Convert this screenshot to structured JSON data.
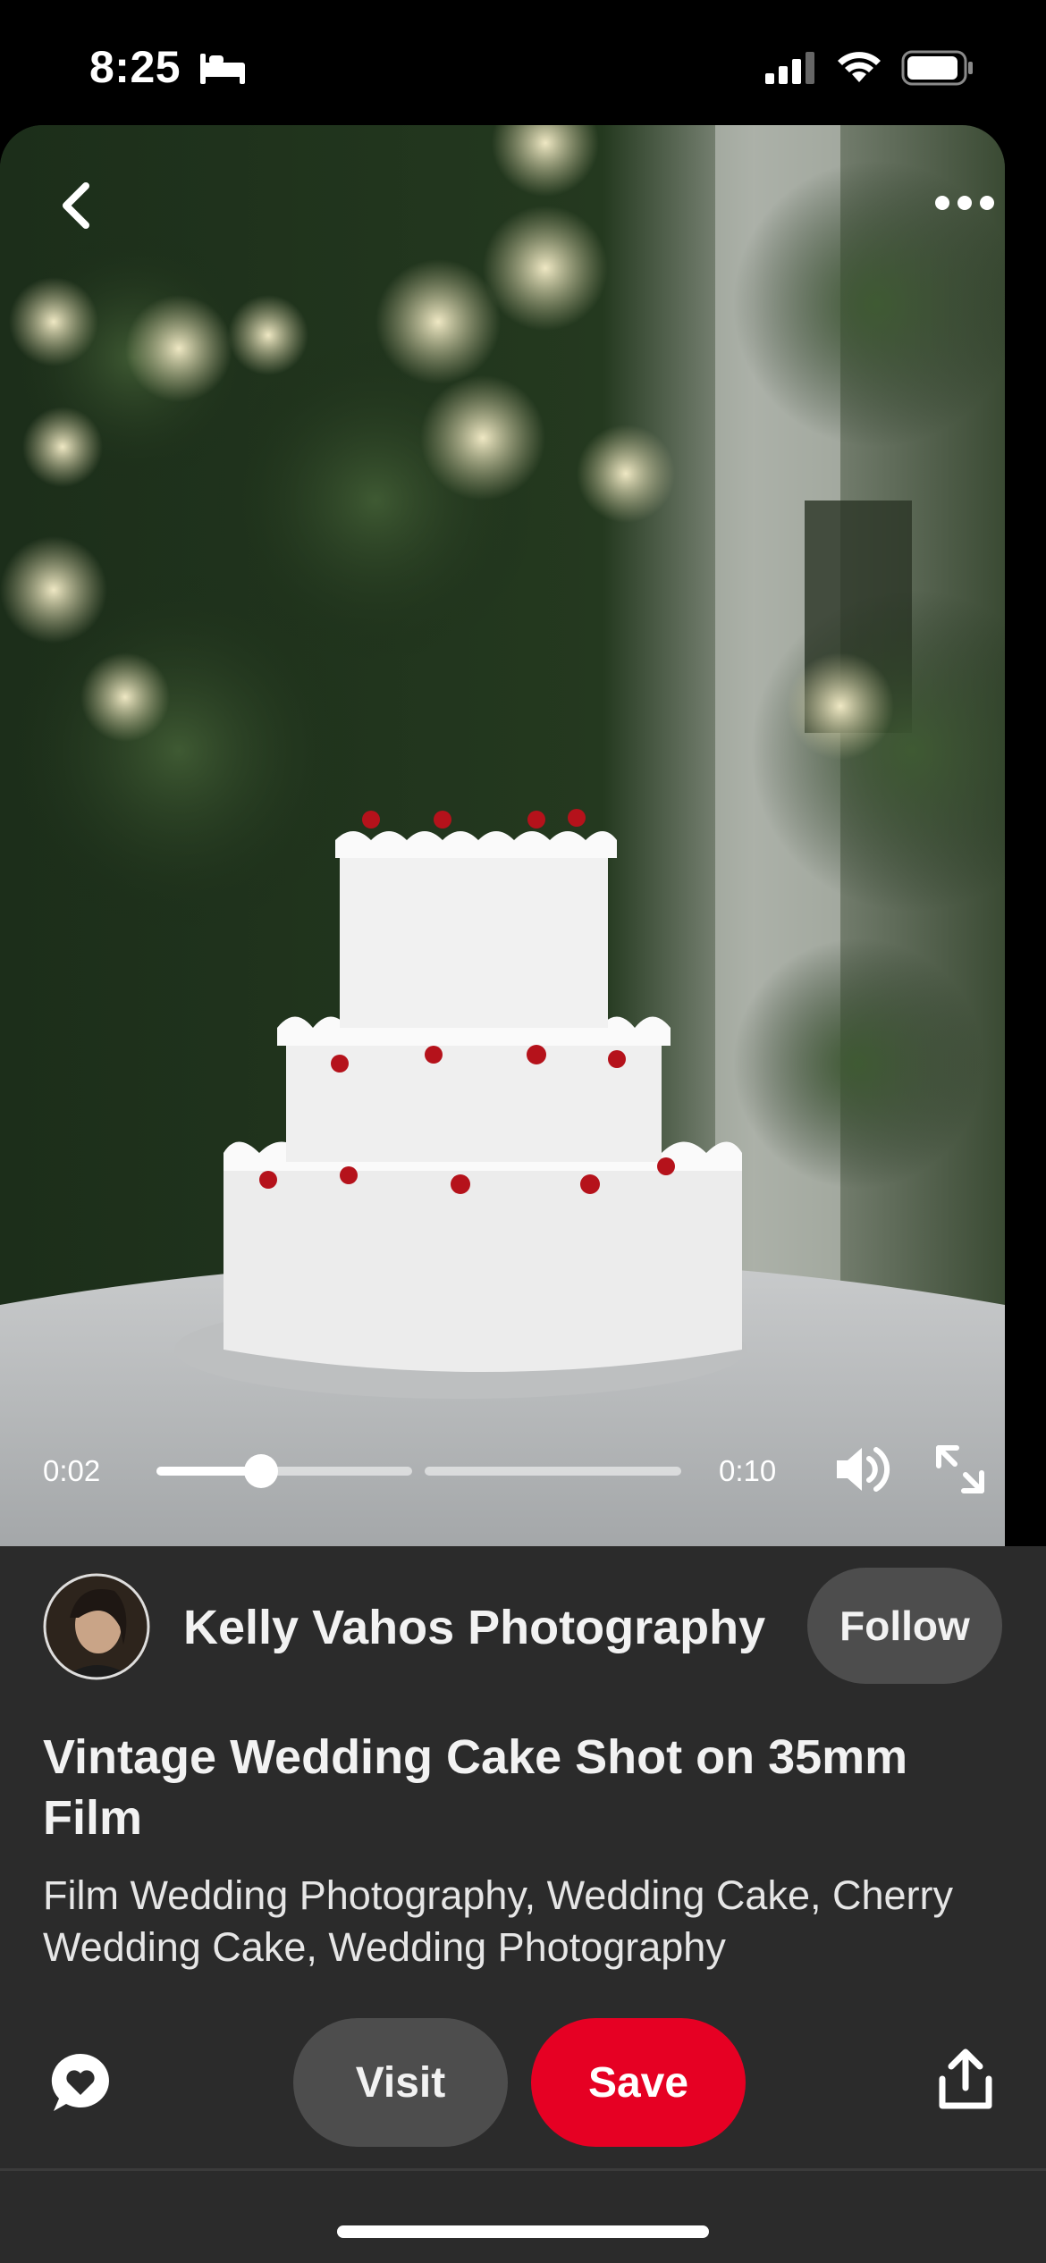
{
  "status_bar": {
    "time": "8:25",
    "icons": [
      "bed-icon",
      "cellular-signal-icon",
      "wifi-icon",
      "battery-icon"
    ]
  },
  "player": {
    "current_time": "0:02",
    "total_time": "0:10",
    "progress_fraction": 0.2,
    "icons": {
      "back": "chevron-left-icon",
      "more": "more-options-icon",
      "volume": "volume-icon",
      "fullscreen": "expand-icon"
    }
  },
  "creator": {
    "name": "Kelly Vahos Photography",
    "follow_label": "Follow"
  },
  "pin": {
    "title": "Vintage Wedding Cake Shot on 35mm Film",
    "tags": "Film Wedding Photography, Wedding Cake, Cherry Wedding Cake, Wedding Photography"
  },
  "actions": {
    "visit_label": "Visit",
    "save_label": "Save",
    "icons": {
      "comment": "comment-heart-icon",
      "share": "share-icon"
    }
  },
  "colors": {
    "save_button": "#e60023",
    "panel_background": "#2b2b2b",
    "secondary_button": "#4d4d4d"
  }
}
